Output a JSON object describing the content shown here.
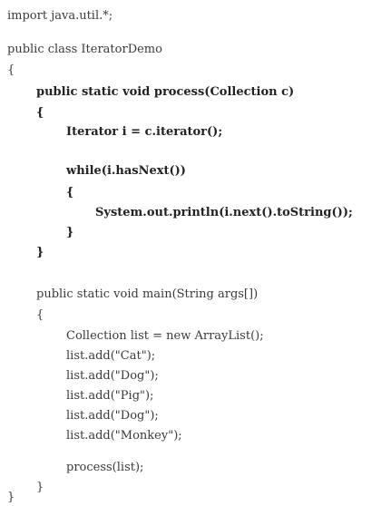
{
  "code_lines": [
    {
      "text": "import java.util.*;",
      "bold": false
    },
    {
      "text": "public class IteratorDemo",
      "bold": false
    },
    {
      "text": "{",
      "bold": false
    },
    {
      "text": "public static void process(Collection c)",
      "bold": true
    },
    {
      "text": "{",
      "bold": true
    },
    {
      "text": "Iterator i = c.iterator();",
      "bold": true
    },
    {
      "text": "while(i.hasNext())",
      "bold": true
    },
    {
      "text": "{",
      "bold": true
    },
    {
      "text": "System.out.println(i.next().toString());",
      "bold": true
    },
    {
      "text": "}",
      "bold": true
    },
    {
      "text": "}",
      "bold": true
    },
    {
      "text": "public static void main(String args[])",
      "bold": false
    },
    {
      "text": "{",
      "bold": false
    },
    {
      "text": "Collection list = new ArrayList();",
      "bold": false
    },
    {
      "text": "list.add(\"Cat\");",
      "bold": false
    },
    {
      "text": "list.add(\"Dog\");",
      "bold": false
    },
    {
      "text": "list.add(\"Pig\");",
      "bold": false
    },
    {
      "text": "list.add(\"Dog\");",
      "bold": false
    },
    {
      "text": "list.add(\"Monkey\");",
      "bold": false
    },
    {
      "text": "process(list);",
      "bold": false
    },
    {
      "text": "}",
      "bold": false
    },
    {
      "text": "}",
      "bold": false
    }
  ]
}
